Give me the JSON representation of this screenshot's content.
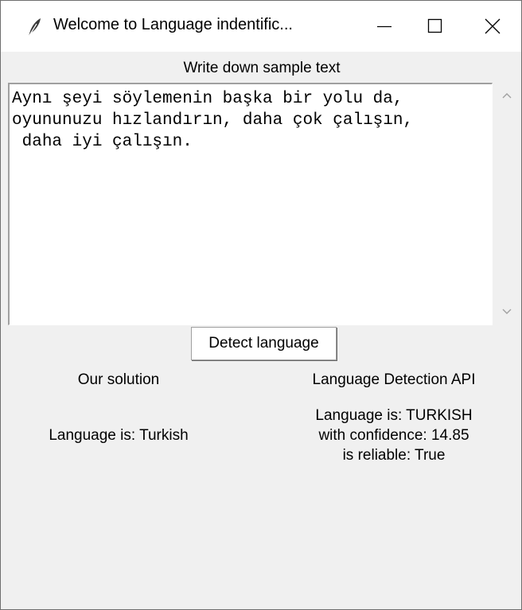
{
  "window": {
    "title": "Welcome to Language indentific...",
    "icon": "feather-icon",
    "controls": [
      "minimize-icon",
      "maximize-icon",
      "close-icon"
    ]
  },
  "input": {
    "label": "Write down sample text",
    "text": "Aynı şeyi söylemenin başka bir yolu da,\noyununuzu hızlandırın, daha çok çalışın,\n daha iyi çalışın."
  },
  "detect_button": {
    "label": "Detect language"
  },
  "our_solution": {
    "title": "Our solution",
    "result": "Language is: Turkish"
  },
  "api": {
    "title": "Language Detection API",
    "lines": [
      "Language is: TURKISH",
      "with confidence: 14.85",
      "is reliable: True"
    ]
  }
}
